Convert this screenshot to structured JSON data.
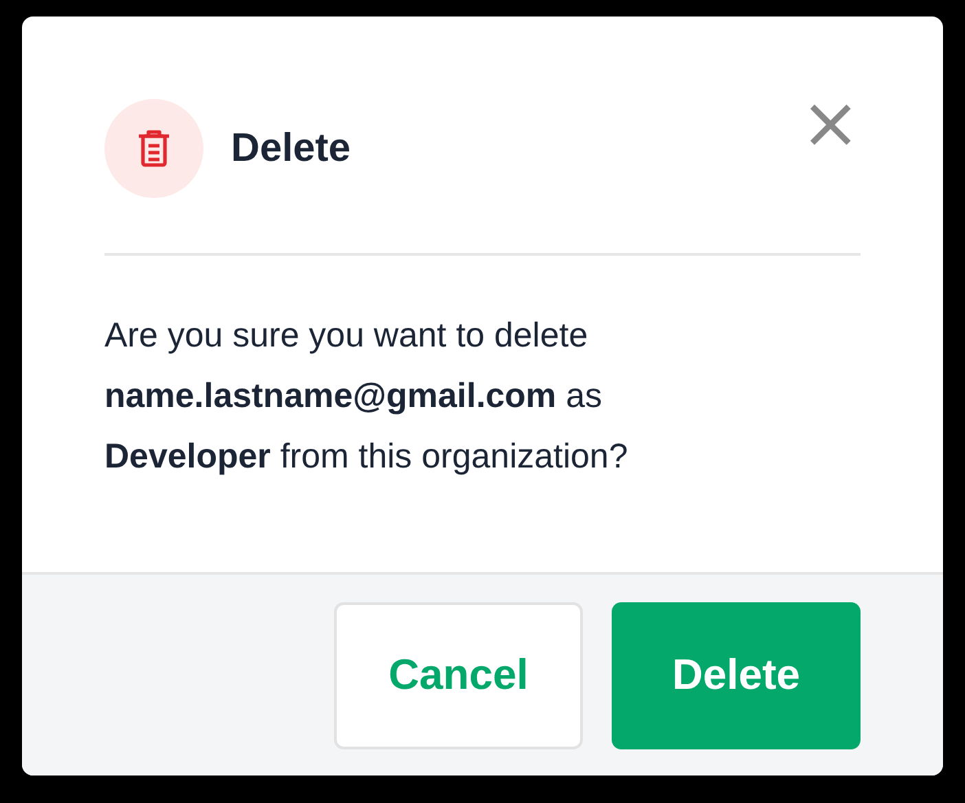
{
  "dialog": {
    "title": "Delete",
    "close_label": "×",
    "message_lines": [
      "Are you sure you want to delete",
      "**name.lastname@gmail.com** as",
      "**Developer** from this organization?"
    ],
    "buttons": [
      {
        "label": "Cancel",
        "kind": "secondary"
      },
      {
        "label": "Delete",
        "kind": "primary"
      }
    ]
  }
}
